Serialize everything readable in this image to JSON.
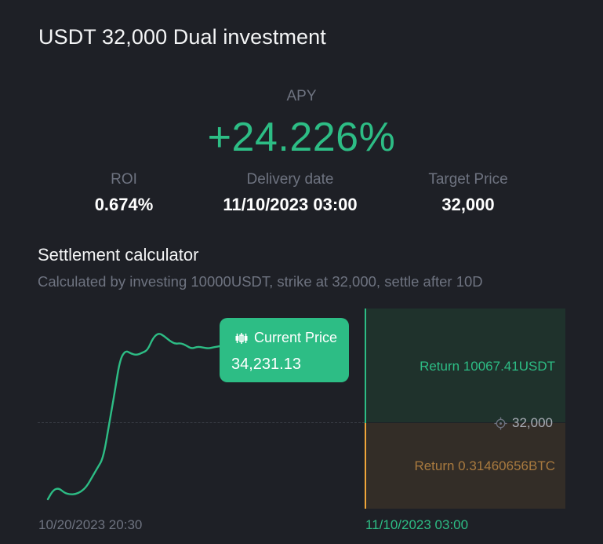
{
  "header": {
    "title": "USDT 32,000 Dual investment"
  },
  "apy": {
    "label": "APY",
    "value": "+24.226%"
  },
  "stats": {
    "roi": {
      "label": "ROI",
      "value": "0.674%"
    },
    "delivery": {
      "label": "Delivery date",
      "value": "11/10/2023 03:00"
    },
    "target": {
      "label": "Target Price",
      "value": "32,000"
    }
  },
  "calculator": {
    "title": "Settlement calculator",
    "subtitle": "Calculated by investing 10000USDT, strike at 32,000, settle after 10D",
    "return_up": "Return 10067.41USDT",
    "return_down": "Return 0.31460656BTC",
    "strike_label": "32,000",
    "current_price_label": "Current Price",
    "current_price_value": "34,231.13",
    "start_date": "10/20/2023 20:30",
    "end_date": "11/10/2023 03:00",
    "icons": {
      "tooltip": "candlestick-icon",
      "strike": "crosshair-icon"
    },
    "colors": {
      "up": "#2dbd85",
      "down": "#f0a63a"
    }
  },
  "chart_data": {
    "type": "line",
    "series": [
      {
        "values": [
          29400,
          29700,
          29750,
          29600,
          29550,
          29560,
          29640,
          29800,
          30100,
          30400,
          30700,
          31700,
          32700,
          33800,
          34100,
          34000,
          33950,
          34020,
          34100,
          34500,
          34650,
          34550,
          34400,
          34300,
          34330,
          34250,
          34150,
          34220,
          34190,
          34160,
          34200,
          34231.13
        ]
      }
    ],
    "reference_line": 32000,
    "x_start": "10/20/2023 20:30",
    "x_end": "11/10/2023 03:00"
  }
}
